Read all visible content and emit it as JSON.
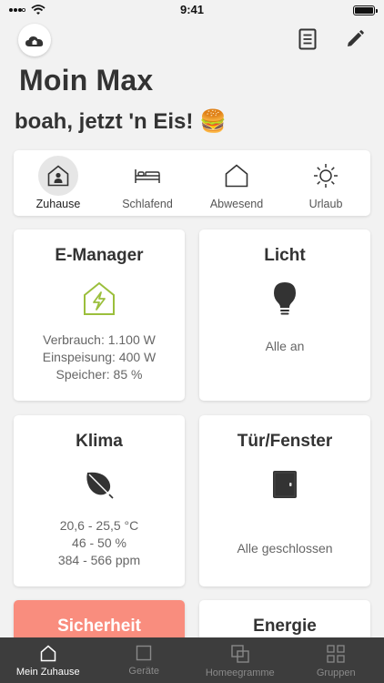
{
  "status": {
    "time": "9:41"
  },
  "greeting": "Moin Max",
  "subline": "boah, jetzt 'n Eis! 🍔",
  "modes": [
    {
      "label": "Zuhause",
      "icon": "home-person-icon",
      "active": true
    },
    {
      "label": "Schlafend",
      "icon": "bed-icon",
      "active": false
    },
    {
      "label": "Abwesend",
      "icon": "house-outline-icon",
      "active": false
    },
    {
      "label": "Urlaub",
      "icon": "sun-icon",
      "active": false
    }
  ],
  "cards": {
    "emanager": {
      "title": "E-Manager",
      "lines": [
        "Verbrauch: 1.100 W",
        "Einspeisung: 400 W",
        "Speicher: 85 %"
      ]
    },
    "licht": {
      "title": "Licht",
      "status": "Alle an"
    },
    "klima": {
      "title": "Klima",
      "lines": [
        "20,6 - 25,5 °C",
        "46 - 50 %",
        "384 - 566 ppm"
      ]
    },
    "tuer": {
      "title": "Tür/Fenster",
      "status": "Alle geschlossen"
    },
    "sicherheit": {
      "title": "Sicherheit"
    },
    "energie": {
      "title": "Energie"
    }
  },
  "tabs": [
    {
      "label": "Mein Zuhause",
      "active": true
    },
    {
      "label": "Geräte",
      "active": false
    },
    {
      "label": "Homeegramme",
      "active": false
    },
    {
      "label": "Gruppen",
      "active": false
    }
  ],
  "colors": {
    "accent_green": "#9bbf3c",
    "security_red": "#f98d7e",
    "tabbar": "#3d3d3d"
  }
}
